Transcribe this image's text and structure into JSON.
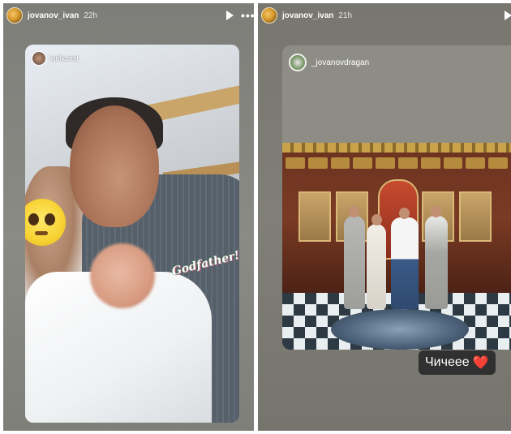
{
  "left_story": {
    "username": "jovanov_ivan",
    "time": "22h",
    "shared_post": {
      "username": "kirilkumit",
      "sticker_text": "Godfather!"
    }
  },
  "right_story": {
    "username": "jovanov_ivan",
    "time": "21h",
    "shared_post": {
      "username": "_jovanovdragan"
    },
    "caption_sticker": "Чичеее",
    "caption_emoji": "❤️"
  },
  "colors": {
    "story_bg_left": "#808179",
    "story_bg_right": "#7a7972",
    "sticker_bg": "#303030",
    "heart": "#e53030"
  },
  "icons": {
    "play": "play-icon",
    "more": "more-icon",
    "heart": "heart-icon"
  }
}
